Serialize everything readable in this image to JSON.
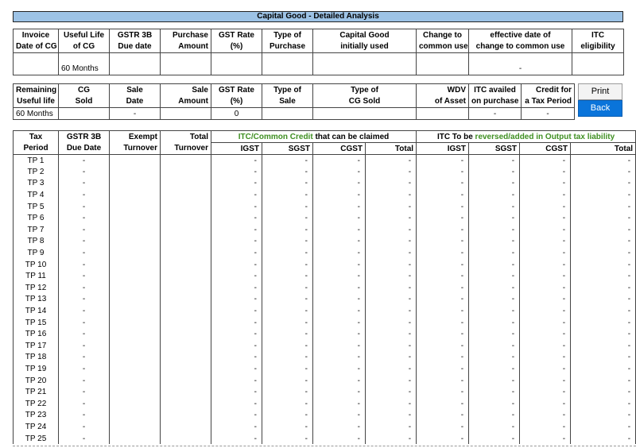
{
  "title": "Capital Good - Detailed Analysis",
  "table1": {
    "headers_line1": [
      "Invoice",
      "Useful Life",
      "GSTR 3B",
      "Purchase",
      "GST Rate",
      "Type of",
      "Capital Good",
      "Change to",
      "effective date of",
      "ITC"
    ],
    "headers_line2": [
      "Date of CG",
      "of CG",
      "Due date",
      "Amount",
      "(%)",
      "Purchase",
      "initially used",
      "common use",
      "change to common use",
      "eligibility"
    ],
    "values": [
      "",
      "60 Months",
      "",
      "",
      "",
      "",
      "",
      "",
      "-",
      ""
    ]
  },
  "table2": {
    "headers_line1": [
      "Remaining",
      "CG",
      "Sale",
      "Sale",
      "GST Rate",
      "Type of",
      "Type of",
      "WDV",
      "ITC availed",
      "Credit for"
    ],
    "headers_line2": [
      "Useful life",
      "Sold",
      "Date",
      "Amount",
      "(%)",
      "Sale",
      "CG Sold",
      "of Asset",
      "on purchase",
      "a Tax Period"
    ],
    "values": [
      "60 Months",
      "",
      "-",
      "",
      "0",
      "",
      "",
      "",
      "-",
      "-"
    ]
  },
  "buttons": {
    "print": "Print",
    "back": "Back"
  },
  "table3": {
    "col_headers_line1": [
      "Tax",
      "GSTR 3B",
      "Exempt",
      "Total"
    ],
    "col_headers_line2": [
      "Period",
      "Due Date",
      "Turnover",
      "Turnover"
    ],
    "itc_group": {
      "part_green": "ITC/Common Credit",
      "part_black": " that can be claimed"
    },
    "rev_group": {
      "part_black": "ITC To be ",
      "part_green": "reversed/added in Output tax liability"
    },
    "sub_headers": [
      "IGST",
      "SGST",
      "CGST",
      "Total",
      "IGST",
      "SGST",
      "CGST",
      "Total"
    ],
    "dash": "-",
    "periods": [
      "TP 1",
      "TP 2",
      "TP 3",
      "TP 4",
      "TP 5",
      "TP 6",
      "TP 7",
      "TP 8",
      "TP 9",
      "TP 10",
      "TP 11",
      "TP 12",
      "TP 13",
      "TP 14",
      "TP 15",
      "TP 16",
      "TP 17",
      "TP 18",
      "TP 19",
      "TP 20",
      "TP 21",
      "TP 22",
      "TP 23",
      "TP 24",
      "TP 25"
    ]
  }
}
